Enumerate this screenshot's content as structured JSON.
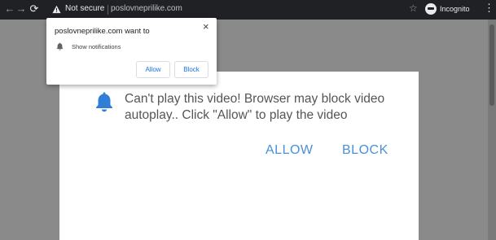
{
  "browser": {
    "security_label": "Not secure",
    "url": "poslovneprilike.com",
    "profile_label": "Incognito"
  },
  "permission_popup": {
    "title": "poslovneprilike.com want to",
    "permission": "Show notifications",
    "allow_label": "Allow",
    "block_label": "Block",
    "close_glyph": "×"
  },
  "modal": {
    "message": "Can't play this video! Browser may block video autoplay.. Click \"Allow\" to play the video",
    "allow_label": "ALLOW",
    "block_label": "BLOCK",
    "accent_color": "#4a90d9",
    "bell_color": "#2f7fd8"
  },
  "icons": {
    "back": "left-arrow-icon",
    "forward": "right-arrow-icon",
    "reload": "reload-icon",
    "warning": "warning-triangle-icon",
    "star": "star-icon",
    "incognito": "incognito-icon",
    "menu": "kebab-menu-icon",
    "bell": "bell-icon"
  }
}
